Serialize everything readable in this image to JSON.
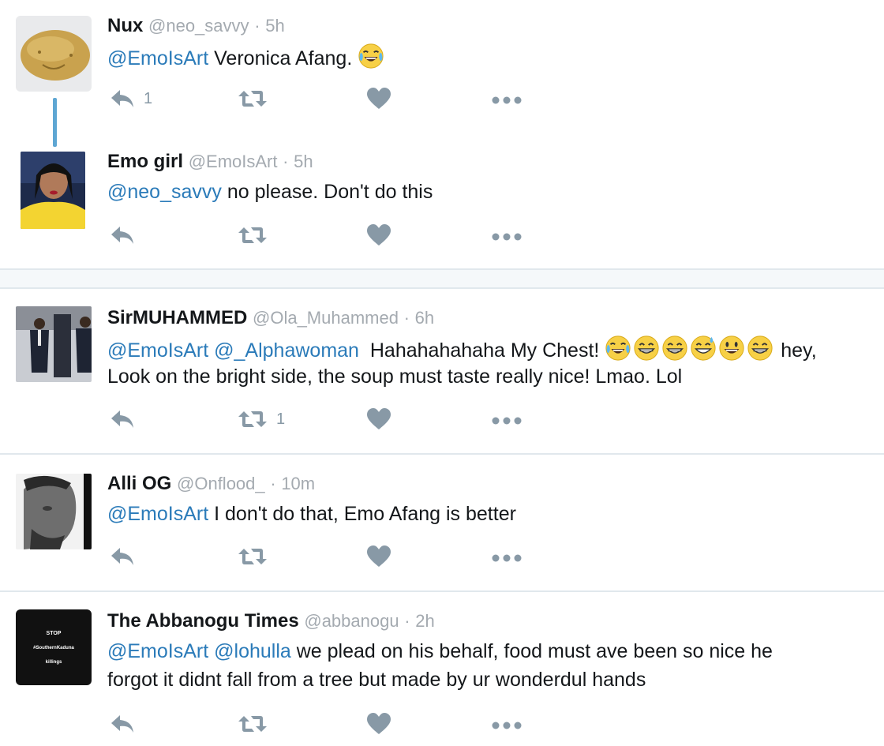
{
  "tweets": [
    {
      "name": "Nux",
      "handle": "@neo_savvy",
      "time": "5h",
      "mentions": [
        "@EmoIsArt"
      ],
      "text": "Veronica Afang.",
      "emojis": [
        "face-with-tears-of-joy"
      ],
      "reply_count": "1",
      "retweet_count": "",
      "avatar": "potato"
    },
    {
      "name": "Emo girl",
      "handle": "@EmoIsArt",
      "time": "5h",
      "mentions": [
        "@neo_savvy"
      ],
      "text": "no please. Don't do this",
      "reply_count": "",
      "retweet_count": "",
      "avatar": "woman-selfie"
    },
    {
      "name": "SirMUHAMMED",
      "handle": "@Ola_Muhammed",
      "time": "6h",
      "mentions": [
        "@EmoIsArt",
        "@_Alphawoman"
      ],
      "text_before_emoji": "Hahahahahaha My Chest!",
      "emojis": [
        "face-with-tears-of-joy",
        "grinning-face-with-smiling-eyes",
        "beaming-face",
        "grinning-face-with-sweat",
        "grinning-face-big-eyes",
        "grinning-face-with-smiling-eyes"
      ],
      "text_after_emoji": "hey,",
      "text_line2": "Look on the bright side, the soup must taste really nice! Lmao. Lol",
      "reply_count": "",
      "retweet_count": "1",
      "avatar": "men-in-suits"
    },
    {
      "name": "Alli OG",
      "handle": "@Onflood_",
      "time": "10m",
      "mentions": [
        "@EmoIsArt"
      ],
      "text": "I don't do that, Emo Afang is better",
      "reply_count": "",
      "retweet_count": "",
      "avatar": "man-profile-bw"
    },
    {
      "name": "The Abbanogu Times",
      "handle": "@abbanogu",
      "time": "2h",
      "mentions": [
        "@EmoIsArt",
        "@lohulla"
      ],
      "text_line1": "we plead on his behalf, food must ave been so nice he",
      "text_line2": "forgot it didnt fall from a tree but made by ur wonderdul hands",
      "reply_count": "",
      "retweet_count": "",
      "avatar": "black-stop-badge",
      "avatar_text": [
        "STOP",
        "#SouthernKaduna",
        "killings"
      ]
    }
  ],
  "separator": "·",
  "colors": {
    "mention": "#2b7bb9",
    "meta": "#a4aab0",
    "action": "#8899a6",
    "thread": "#5ea6d3"
  }
}
